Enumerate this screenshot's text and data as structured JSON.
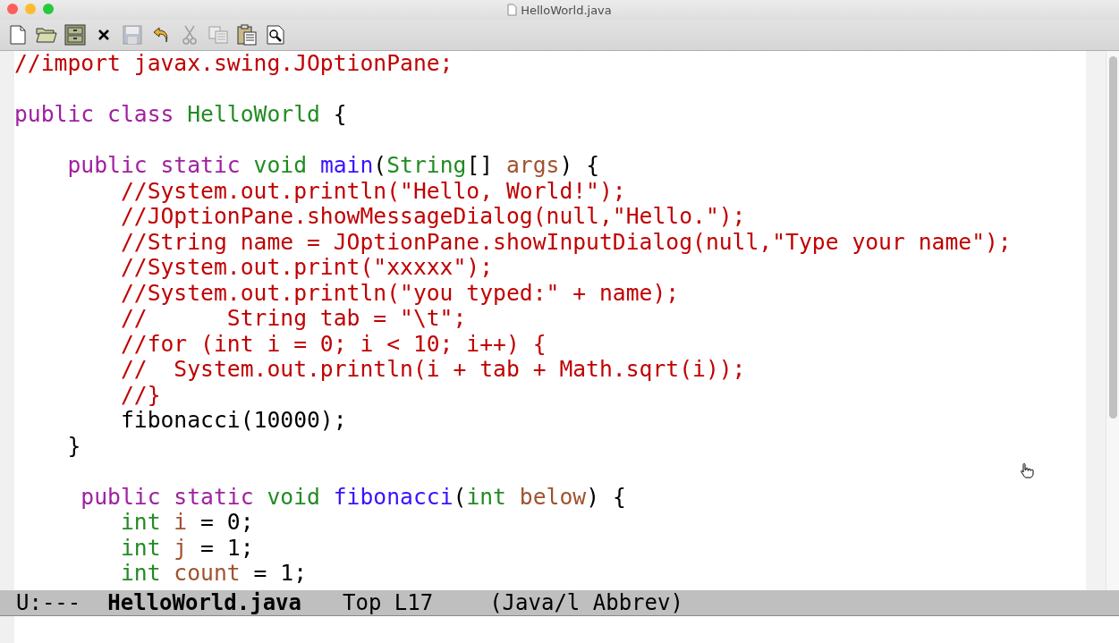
{
  "window": {
    "title": "HelloWorld.java"
  },
  "toolbar": [
    {
      "kind": "new",
      "disabled": false
    },
    {
      "kind": "open",
      "disabled": false
    },
    {
      "kind": "cabinet",
      "disabled": false
    },
    {
      "kind": "close",
      "disabled": false
    },
    {
      "kind": "save",
      "disabled": true
    },
    {
      "kind": "undo",
      "disabled": false
    },
    {
      "kind": "cut",
      "disabled": true
    },
    {
      "kind": "copy",
      "disabled": true
    },
    {
      "kind": "paste",
      "disabled": false
    },
    {
      "kind": "search",
      "disabled": false
    }
  ],
  "editor": {
    "lines": [
      {
        "kind": "code",
        "tokens": [
          {
            "text": "//import javax.swing.JOptionPane;",
            "kind": "comment"
          }
        ]
      },
      {
        "kind": "blank"
      },
      {
        "kind": "code",
        "tokens": [
          {
            "text": "public class ",
            "kind": "keyword"
          },
          {
            "text": "HelloWorld",
            "kind": "type"
          },
          {
            "text": " {",
            "kind": "plain"
          }
        ]
      },
      {
        "kind": "blank"
      },
      {
        "kind": "code",
        "tokens": [
          {
            "text": "    public static ",
            "kind": "keyword"
          },
          {
            "text": "void ",
            "kind": "type"
          },
          {
            "text": "main",
            "kind": "function"
          },
          {
            "text": "(",
            "kind": "plain"
          },
          {
            "text": "String",
            "kind": "type"
          },
          {
            "text": "[] ",
            "kind": "plain"
          },
          {
            "text": "args",
            "kind": "variable"
          },
          {
            "text": ") {",
            "kind": "plain"
          }
        ]
      },
      {
        "kind": "code",
        "tokens": [
          {
            "text": "        //System.out.println(\"Hello, World!\");",
            "kind": "comment"
          }
        ]
      },
      {
        "kind": "code",
        "tokens": [
          {
            "text": "        //JOptionPane.showMessageDialog(null,\"Hello.\");",
            "kind": "comment"
          }
        ]
      },
      {
        "kind": "code",
        "tokens": [
          {
            "text": "        //String name = JOptionPane.showInputDialog(null,\"Type your name\");",
            "kind": "comment"
          }
        ]
      },
      {
        "kind": "code",
        "tokens": [
          {
            "text": "        //System.out.print(\"xxxxx\");",
            "kind": "comment"
          }
        ]
      },
      {
        "kind": "code",
        "tokens": [
          {
            "text": "        //System.out.println(\"you typed:\" + name);",
            "kind": "comment"
          }
        ]
      },
      {
        "kind": "code",
        "tokens": [
          {
            "text": "        //      String tab = \"\\t\";",
            "kind": "comment"
          }
        ]
      },
      {
        "kind": "code",
        "tokens": [
          {
            "text": "        //for (int i = 0; i < 10; i++) {",
            "kind": "comment"
          }
        ]
      },
      {
        "kind": "code",
        "tokens": [
          {
            "text": "        //  System.out.println(i + tab + Math.sqrt(i));",
            "kind": "comment"
          }
        ]
      },
      {
        "kind": "code",
        "tokens": [
          {
            "text": "        //}",
            "kind": "comment"
          }
        ]
      },
      {
        "kind": "code",
        "tokens": [
          {
            "text": "        fibonacci(10000);",
            "kind": "plain"
          }
        ]
      },
      {
        "kind": "code",
        "tokens": [
          {
            "text": "    }",
            "kind": "plain"
          }
        ]
      },
      {
        "kind": "blank"
      },
      {
        "kind": "code",
        "tokens": [
          {
            "text": "     public static ",
            "kind": "keyword"
          },
          {
            "text": "void ",
            "kind": "type"
          },
          {
            "text": "fibonacci",
            "kind": "function"
          },
          {
            "text": "(",
            "kind": "plain"
          },
          {
            "text": "int ",
            "kind": "type"
          },
          {
            "text": "below",
            "kind": "variable"
          },
          {
            "text": ") {",
            "kind": "plain"
          }
        ]
      },
      {
        "kind": "code",
        "tokens": [
          {
            "text": "        int ",
            "kind": "type"
          },
          {
            "text": "i",
            "kind": "variable"
          },
          {
            "text": " = 0;",
            "kind": "plain"
          }
        ]
      },
      {
        "kind": "code",
        "tokens": [
          {
            "text": "        int ",
            "kind": "type"
          },
          {
            "text": "j",
            "kind": "variable"
          },
          {
            "text": " = 1;",
            "kind": "plain"
          }
        ]
      },
      {
        "kind": "code",
        "tokens": [
          {
            "text": "        int ",
            "kind": "type"
          },
          {
            "text": "count",
            "kind": "variable"
          },
          {
            "text": " = 1;",
            "kind": "plain"
          }
        ]
      }
    ]
  },
  "mode_line": {
    "status": "U:---",
    "buffer": "HelloWorld.java",
    "position": "Top L17",
    "mode": "(Java/l Abbrev)"
  }
}
